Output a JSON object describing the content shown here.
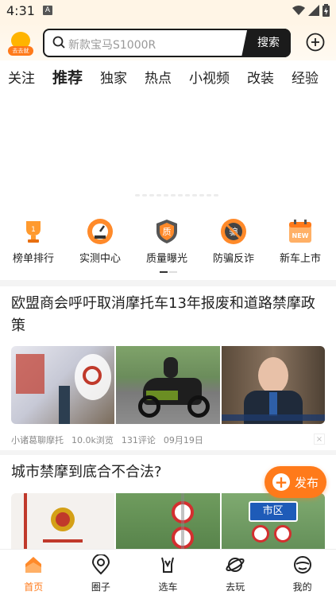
{
  "status_bar": {
    "time": "4:31",
    "notif_letter": "A"
  },
  "header": {
    "logo_text": "去去就",
    "search_placeholder": "新款宝马S1000R",
    "search_button": "搜索"
  },
  "tabs": [
    {
      "label": "关注",
      "active": false
    },
    {
      "label": "推荐",
      "active": true
    },
    {
      "label": "独家",
      "active": false
    },
    {
      "label": "热点",
      "active": false
    },
    {
      "label": "小视频",
      "active": false
    },
    {
      "label": "改装",
      "active": false
    },
    {
      "label": "经验",
      "active": false
    }
  ],
  "quick_links": [
    {
      "label": "榜单排行",
      "icon": "trophy-icon",
      "badge": "1"
    },
    {
      "label": "实测中心",
      "icon": "speedometer-icon",
      "badge": ""
    },
    {
      "label": "质量曝光",
      "icon": "quality-shield-icon",
      "badge": "质"
    },
    {
      "label": "防骗反诈",
      "icon": "anti-fraud-icon",
      "badge": "骗"
    },
    {
      "label": "新车上市",
      "icon": "new-calendar-icon",
      "badge": "NEW"
    }
  ],
  "articles": [
    {
      "title": "欧盟商会呼吁取消摩托车13年报废和道路禁摩政策",
      "source": "小诸葛聊摩托",
      "views": "10.0k浏览",
      "comments": "131评论",
      "date": "09月19日"
    },
    {
      "title": "城市禁摩到底合不合法?",
      "sign_text": "市区"
    }
  ],
  "fab": {
    "label": "发布"
  },
  "bottom_nav": [
    {
      "label": "首页",
      "icon": "home-icon",
      "active": true
    },
    {
      "label": "圈子",
      "icon": "circle-community-icon",
      "active": false
    },
    {
      "label": "选车",
      "icon": "select-car-icon",
      "active": false
    },
    {
      "label": "去玩",
      "icon": "planet-icon",
      "active": false
    },
    {
      "label": "我的",
      "icon": "profile-icon",
      "active": false
    }
  ],
  "colors": {
    "accent": "#ff7a1a",
    "dark": "#1b1b1b",
    "header_bg": "#fff5e6"
  }
}
